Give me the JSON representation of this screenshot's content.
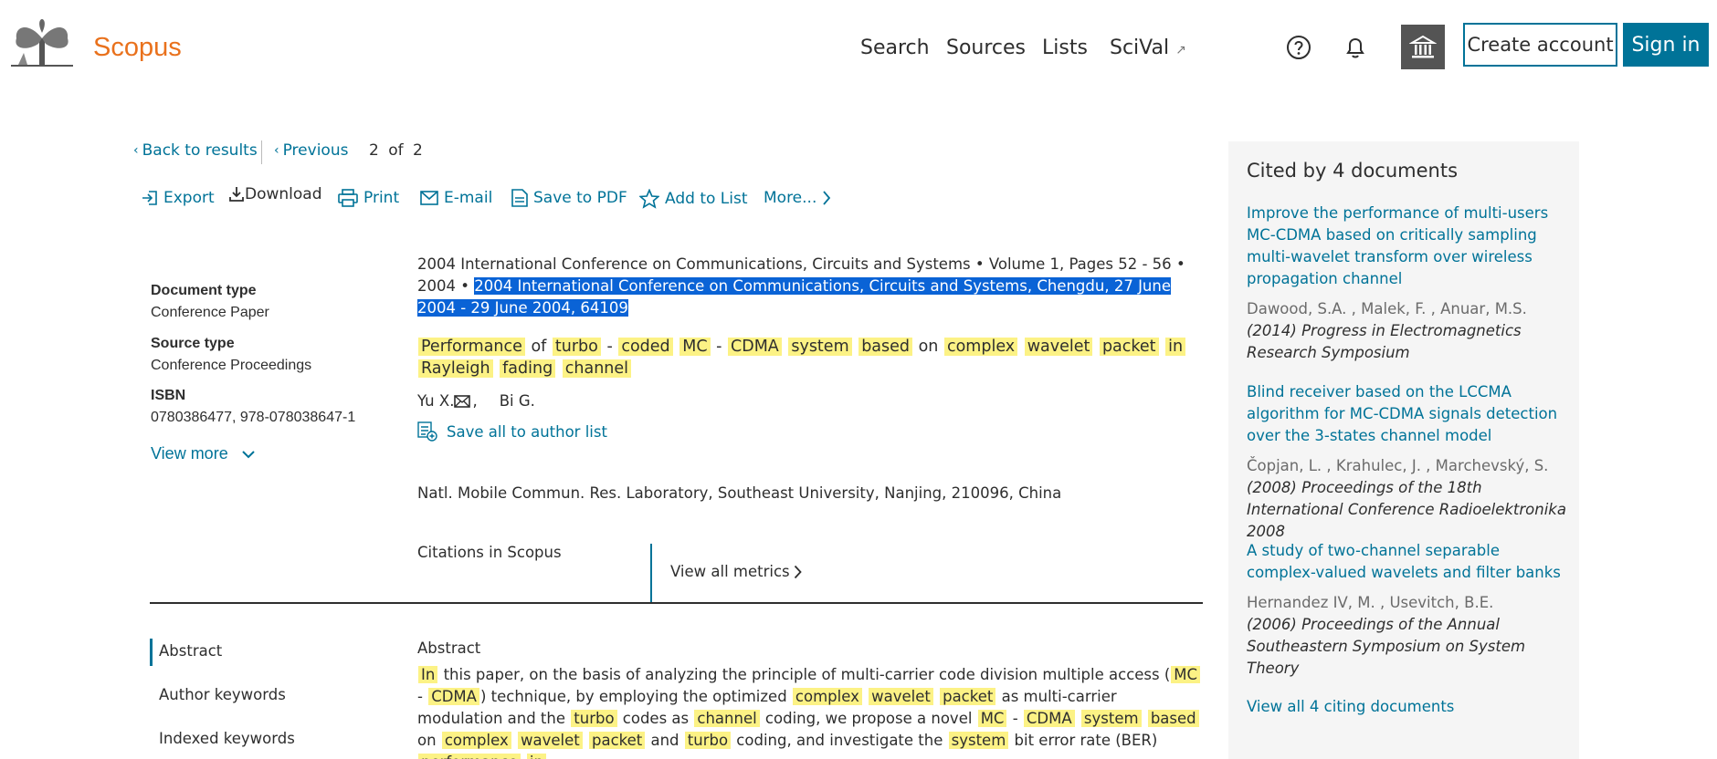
{
  "header": {
    "logo": "Scopus",
    "nav": [
      "Search",
      "Sources",
      "Lists",
      "SciVal"
    ],
    "scival_arrow": "↗",
    "create_account": "Create account",
    "sign_in": "Sign in"
  },
  "breadcrumb": {
    "back": "Back to results",
    "previous": "Previous",
    "current": "2",
    "of": "of",
    "total": "2"
  },
  "toolbar": {
    "export": "Export",
    "download": "Download",
    "print": "Print",
    "email": "E-mail",
    "save_pdf": "Save to PDF",
    "add_list": "Add to List",
    "more": "More..."
  },
  "meta": {
    "doc_type_label": "Document type",
    "doc_type_value": "Conference Paper",
    "source_type_label": "Source type",
    "source_type_value": "Conference Proceedings",
    "isbn_label": "ISBN",
    "isbn_value": "0780386477, 978-078038647-1",
    "view_more": "View more"
  },
  "document": {
    "source": "2004 International Conference on Communications, Circuits and Systems",
    "volume": "Volume 1, Pages 52 - 56",
    "year": "2004",
    "conference": "2004 International Conference on Communications, Circuits and Systems, Chengdu, 27 June 2004 - 29 June 2004, 64109",
    "title_words": [
      {
        "t": "Performance",
        "h": true
      },
      {
        "t": " of ",
        "h": false
      },
      {
        "t": "turbo",
        "h": true
      },
      {
        "t": " - ",
        "h": false
      },
      {
        "t": "coded",
        "h": true
      },
      {
        "t": " ",
        "h": false
      },
      {
        "t": "MC",
        "h": true
      },
      {
        "t": " - ",
        "h": false
      },
      {
        "t": "CDMA",
        "h": true
      },
      {
        "t": " ",
        "h": false
      },
      {
        "t": "system",
        "h": true
      },
      {
        "t": " ",
        "h": false
      },
      {
        "t": "based",
        "h": true
      },
      {
        "t": " on ",
        "h": false
      },
      {
        "t": "complex",
        "h": true
      },
      {
        "t": " ",
        "h": false
      },
      {
        "t": "wavelet",
        "h": true
      },
      {
        "t": " ",
        "h": false
      },
      {
        "t": "packet",
        "h": true
      },
      {
        "t": " ",
        "h": false
      },
      {
        "t": "in",
        "h": true
      },
      {
        "t": " ",
        "h": false
      },
      {
        "t": "Rayleigh",
        "h": true
      },
      {
        "t": " ",
        "h": false
      },
      {
        "t": "fading",
        "h": true
      },
      {
        "t": " ",
        "h": false
      },
      {
        "t": "channel",
        "h": true
      }
    ],
    "author1": "Yu X.",
    "author2": "Bi G.",
    "save_authors": "Save all to author list",
    "affiliation": "Natl. Mobile Commun. Res. Laboratory, Southeast University, Nanjing, 210096, China",
    "citations_label": "Citations in Scopus",
    "view_all_metrics": "View all metrics"
  },
  "sections": [
    "Abstract",
    "Author keywords",
    "Indexed keywords"
  ],
  "abstract": {
    "heading": "Abstract",
    "words": [
      {
        "t": "In",
        "h": true
      },
      {
        "t": " this paper, on the basis of analyzing the principle of multi-carrier code division multiple access (",
        "h": false
      },
      {
        "t": "MC",
        "h": true
      },
      {
        "t": " - ",
        "h": false
      },
      {
        "t": "CDMA",
        "h": true
      },
      {
        "t": ") technique, by employing the optimized ",
        "h": false
      },
      {
        "t": "complex",
        "h": true
      },
      {
        "t": " ",
        "h": false
      },
      {
        "t": "wavelet",
        "h": true
      },
      {
        "t": " ",
        "h": false
      },
      {
        "t": "packet",
        "h": true
      },
      {
        "t": " as multi-carrier modulation and the ",
        "h": false
      },
      {
        "t": "turbo",
        "h": true
      },
      {
        "t": " codes as ",
        "h": false
      },
      {
        "t": "channel",
        "h": true
      },
      {
        "t": " coding, we propose a novel ",
        "h": false
      },
      {
        "t": "MC",
        "h": true
      },
      {
        "t": " - ",
        "h": false
      },
      {
        "t": "CDMA",
        "h": true
      },
      {
        "t": " ",
        "h": false
      },
      {
        "t": "system",
        "h": true
      },
      {
        "t": " ",
        "h": false
      },
      {
        "t": "based",
        "h": true
      },
      {
        "t": " on ",
        "h": false
      },
      {
        "t": "complex",
        "h": true
      },
      {
        "t": " ",
        "h": false
      },
      {
        "t": "wavelet",
        "h": true
      },
      {
        "t": " ",
        "h": false
      },
      {
        "t": "packet",
        "h": true
      },
      {
        "t": " and ",
        "h": false
      },
      {
        "t": "turbo",
        "h": true
      },
      {
        "t": " coding, and investigate the ",
        "h": false
      },
      {
        "t": "system",
        "h": true
      },
      {
        "t": " bit error rate (BER) ",
        "h": false
      },
      {
        "t": "performance",
        "h": true
      },
      {
        "t": " ",
        "h": false
      },
      {
        "t": "in",
        "h": true
      }
    ]
  },
  "cited_by": {
    "title": "Cited by 4 documents",
    "items": [
      {
        "title": "Improve the performance of multi-users MC-CDMA based on critically sampling multi-wavelet transform over wireless propagation channel",
        "authors": "Dawood, S.A. , Malek, F. , Anuar, M.S.",
        "source": "(2014) Progress in Electromagnetics Research Symposium"
      },
      {
        "title": "Blind receiver based on the LCCMA algorithm for MC-CDMA signals detection over the 3-states channel model",
        "authors": "Čopjan, L. , Krahulec, J. , Marchevský, S.",
        "source": "(2008) Proceedings of the 18th International Conference Radioelektronika 2008"
      },
      {
        "title": "A study of two-channel separable complex-valued wavelets and filter banks",
        "authors": "Hernandez IV, M. , Usevitch, B.E.",
        "source": "(2006) Proceedings of the Annual Southeastern Symposium on System Theory"
      }
    ],
    "view_all": "View all 4 citing documents"
  },
  "colors": {
    "accent": "#007398",
    "brand": "#e9711c",
    "highlight": "#fcf285",
    "selection": "#0a63d6"
  }
}
